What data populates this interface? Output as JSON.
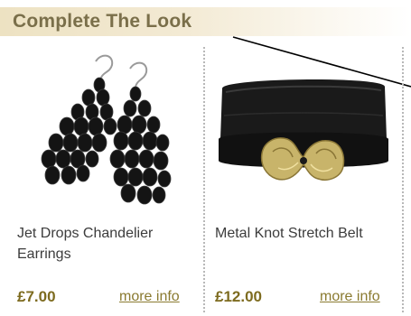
{
  "section": {
    "title": "Complete The Look"
  },
  "products": [
    {
      "name": "Jet Drops Chandelier Earrings",
      "price": "£7.00",
      "more_info_label": "more info",
      "image_icon": "earrings-image"
    },
    {
      "name": "Metal Knot Stretch Belt",
      "price": "£12.00",
      "more_info_label": "more info",
      "image_icon": "belt-image"
    }
  ],
  "colors": {
    "header_bg": "#ede2c2",
    "title_text": "#7a6f4a",
    "price_text": "#7d6b1f",
    "link_text": "#8a7a30",
    "divider": "#b8b8b8"
  }
}
